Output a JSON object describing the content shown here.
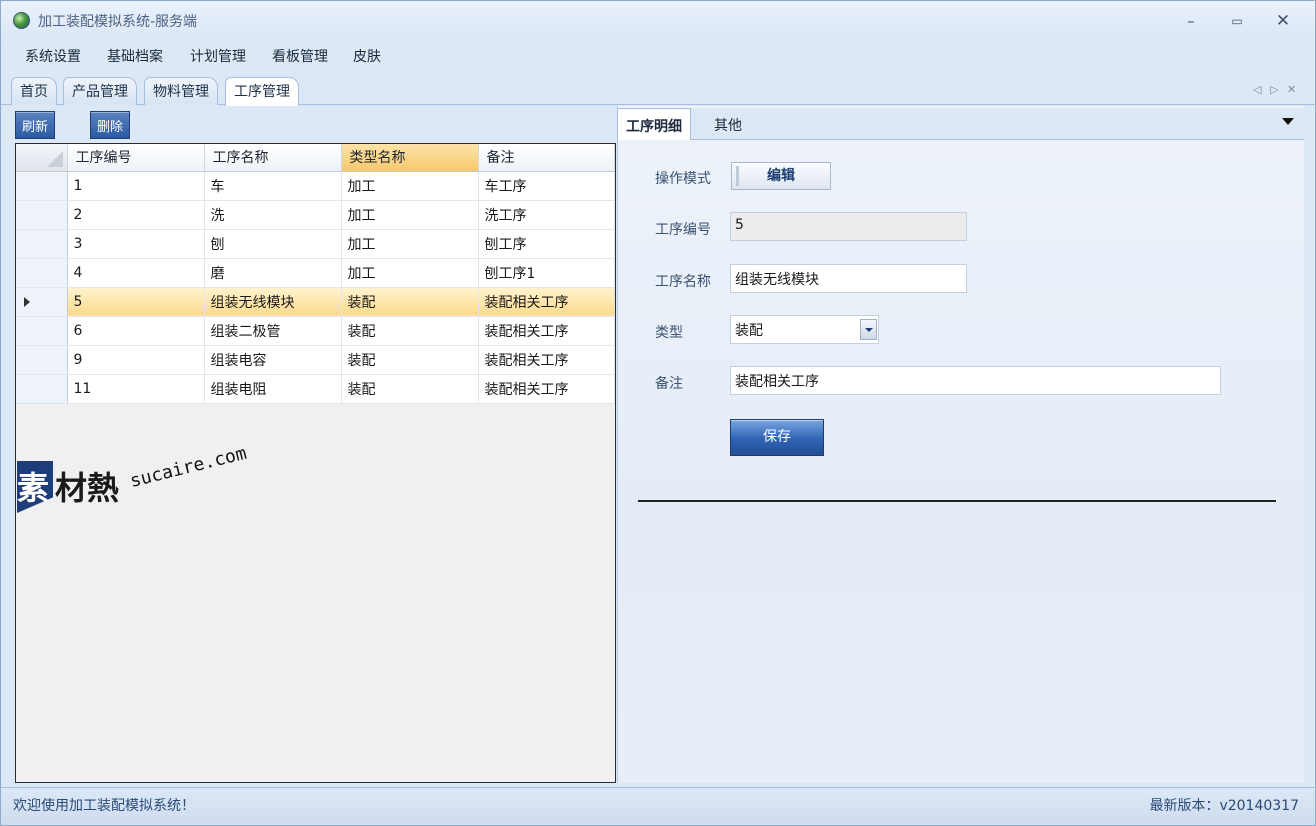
{
  "window": {
    "title": "加工装配模拟系统-服务端",
    "minimize": "–",
    "maximize": "▭",
    "close": "✕"
  },
  "menu": [
    "系统设置",
    "基础档案",
    "计划管理",
    "看板管理",
    "皮肤"
  ],
  "doc_tabs": [
    {
      "label": "首页",
      "active": false
    },
    {
      "label": "产品管理",
      "active": false
    },
    {
      "label": "物料管理",
      "active": false
    },
    {
      "label": "工序管理",
      "active": true
    }
  ],
  "toolbar": {
    "refresh_label": "刷新",
    "delete_label": "删除"
  },
  "grid": {
    "columns": [
      "工序编号",
      "工序名称",
      "类型名称",
      "备注"
    ],
    "sorted_column": "类型名称",
    "rows": [
      [
        "1",
        "车",
        "加工",
        "车工序"
      ],
      [
        "2",
        "洗",
        "加工",
        "洗工序"
      ],
      [
        "3",
        "刨",
        "加工",
        "刨工序"
      ],
      [
        "4",
        "磨",
        "加工",
        "刨工序1"
      ],
      [
        "5",
        "组装无线模块",
        "装配",
        "装配相关工序"
      ],
      [
        "6",
        "组装二极管",
        "装配",
        "装配相关工序"
      ],
      [
        "9",
        "组装电容",
        "装配",
        "装配相关工序"
      ],
      [
        "11",
        "组装电阻",
        "装配",
        "装配相关工序"
      ]
    ],
    "selected_row": 4
  },
  "watermark": {
    "char1": "素",
    "char2": "材熱",
    "url": "sucaire.com"
  },
  "detail_tabs": {
    "active": "工序明细",
    "other": "其他"
  },
  "form": {
    "mode_label": "操作模式",
    "mode_value": "编辑",
    "code_label": "工序编号",
    "code_value": "5",
    "name_label": "工序名称",
    "name_value": "组装无线模块",
    "type_label": "类型",
    "type_value": "装配",
    "remark_label": "备注",
    "remark_value": "装配相关工序",
    "save_label": "保存"
  },
  "status": {
    "welcome": "欢迎使用加工装配模拟系统！",
    "version": "最新版本：v20140317"
  },
  "colors": {
    "accent": "#2e63b4",
    "selected_row": "#fbd98b",
    "sorted_header": "#f6c96b"
  }
}
